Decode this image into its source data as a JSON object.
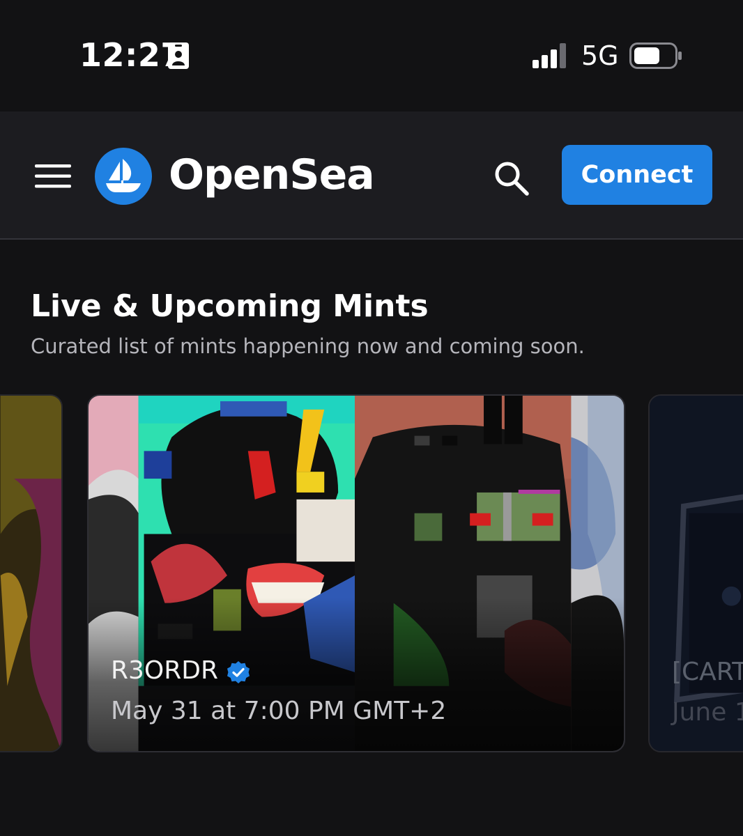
{
  "status_bar": {
    "time": "12:27",
    "network": "5G",
    "icons": [
      "contact-card-icon",
      "cellular-signal-icon",
      "battery-icon"
    ]
  },
  "header": {
    "brand": "OpenSea",
    "connect_label": "Connect",
    "accent_color": "#2081e2",
    "icons": [
      "hamburger-menu-icon",
      "opensea-logo-icon",
      "search-icon"
    ]
  },
  "section": {
    "title": "Live & Upcoming Mints",
    "subtitle": "Curated list of mints happening now and coming soon."
  },
  "mints": [
    {
      "name": "R3ORDR",
      "verified": true,
      "date": "May 31 at 7:00 PM GMT+2"
    },
    {
      "name": "[CART",
      "date": "June 1"
    }
  ]
}
